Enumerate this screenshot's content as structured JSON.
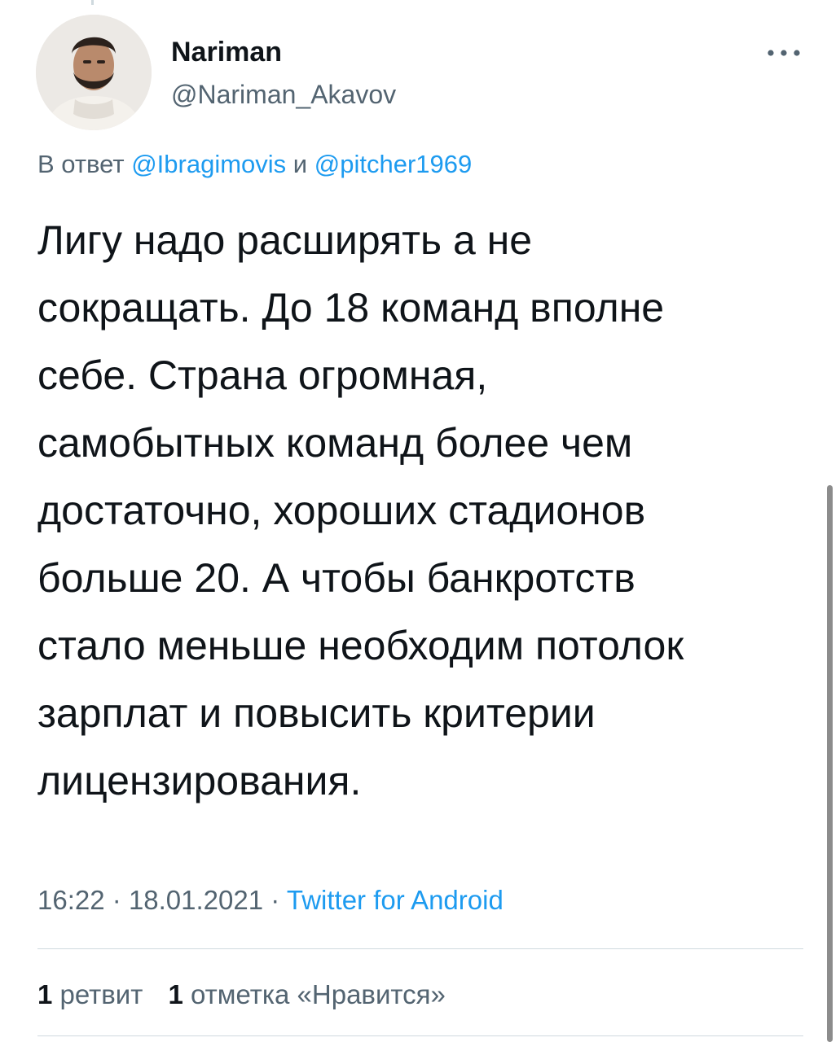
{
  "author": {
    "name": "Nariman",
    "handle": "@Nariman_Akavov"
  },
  "reply_to": {
    "prefix": "В ответ",
    "mention1": "@Ibragimovis",
    "conjunction": "и",
    "mention2": "@pitcher1969"
  },
  "tweet": {
    "lines": [
      "Лигу надо расширять а не",
      "сокращать. До 18 команд вполне",
      "себе. Страна огромная,",
      "самобытных команд более чем",
      "достаточно, хороших стадионов",
      "больше 20. А чтобы банкротств",
      "стало меньше необходим потолок",
      "зарплат и повысить критерии",
      "лицензирования."
    ]
  },
  "meta": {
    "time": "16:22",
    "separator": "·",
    "date": "18.01.2021",
    "source": "Twitter for Android"
  },
  "stats": {
    "retweets_count": "1",
    "retweets_label": "ретвит",
    "likes_count": "1",
    "likes_label": "отметка «Нравится»"
  },
  "icons": {
    "more": "more-horizontal-icon",
    "avatar": "avatar"
  },
  "colors": {
    "link": "#1d9bf0",
    "secondary_text": "#536471",
    "primary_text": "#0f1419",
    "divider": "#cfd9de"
  }
}
